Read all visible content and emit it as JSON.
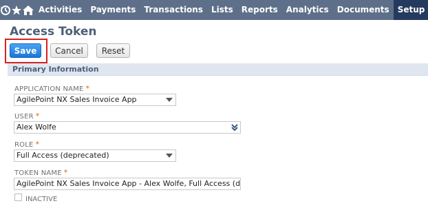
{
  "nav": {
    "icons": [
      "recent-icon",
      "star-icon",
      "home-icon"
    ],
    "items": [
      "Activities",
      "Payments",
      "Transactions",
      "Lists",
      "Reports",
      "Analytics",
      "Documents",
      "Setup"
    ],
    "active_item": "Setup"
  },
  "page": {
    "title": "Access Token"
  },
  "buttons": {
    "save": "Save",
    "cancel": "Cancel",
    "reset": "Reset"
  },
  "section": {
    "title": "Primary Information"
  },
  "form": {
    "application_name": {
      "label": "APPLICATION NAME",
      "value": "AgilePoint NX Sales Invoice App",
      "required": "*"
    },
    "user": {
      "label": "USER",
      "value": "Alex Wolfe",
      "required": "*"
    },
    "role": {
      "label": "ROLE",
      "value": "Full Access (deprecated)",
      "required": "*"
    },
    "token_name": {
      "label": "TOKEN NAME",
      "value": "AgilePoint NX Sales Invoice App - Alex Wolfe, Full Access (deprecated",
      "required": "*"
    },
    "inactive": {
      "label": "INACTIVE",
      "checked": false
    }
  },
  "colors": {
    "nav_bg": "#5e6f8a",
    "nav_active": "#243a5e",
    "save_button": "#1b76d8",
    "highlight": "#d6201f",
    "required": "#e06500"
  }
}
